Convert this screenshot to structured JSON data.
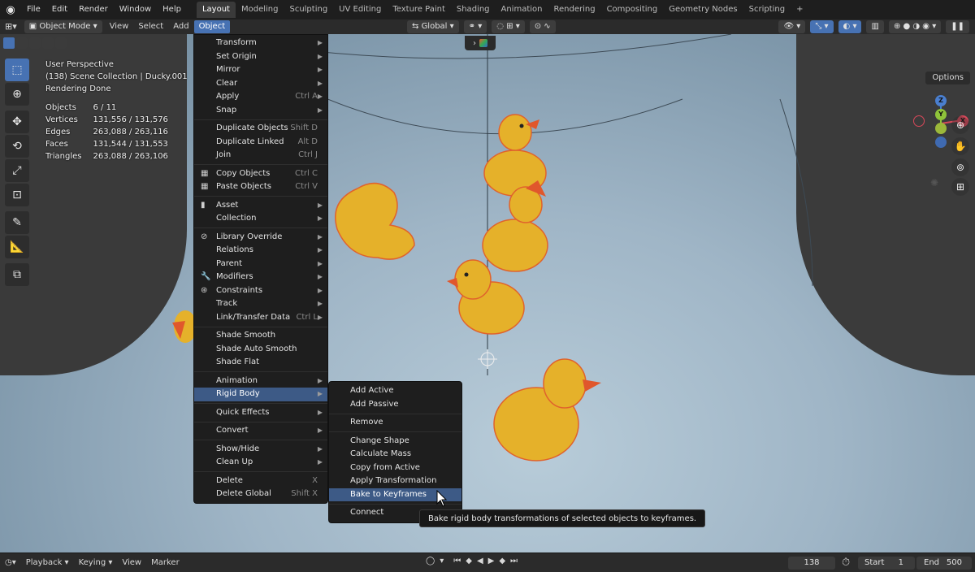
{
  "topbar": {
    "menus": [
      "File",
      "Edit",
      "Render",
      "Window",
      "Help"
    ],
    "workspaces": [
      "Layout",
      "Modeling",
      "Sculpting",
      "UV Editing",
      "Texture Paint",
      "Shading",
      "Animation",
      "Rendering",
      "Compositing",
      "Geometry Nodes",
      "Scripting"
    ],
    "add_tab": "+"
  },
  "header": {
    "mode": "Object Mode",
    "menus": [
      "View",
      "Select",
      "Add",
      "Object"
    ],
    "transform_orientation": "Global",
    "options": "Options"
  },
  "stats": {
    "view": "User Perspective",
    "collection": "(138) Scene Collection | Ducky.001",
    "status": "Rendering Done",
    "rows": [
      {
        "label": "Objects",
        "value": "6 / 11"
      },
      {
        "label": "Vertices",
        "value": "131,556 / 131,576"
      },
      {
        "label": "Edges",
        "value": "263,088 / 263,116"
      },
      {
        "label": "Faces",
        "value": "131,544 / 131,553"
      },
      {
        "label": "Triangles",
        "value": "263,088 / 263,106"
      }
    ]
  },
  "object_menu": [
    {
      "label": "Transform",
      "sub": true
    },
    {
      "label": "Set Origin",
      "sub": true
    },
    {
      "label": "Mirror",
      "sub": true
    },
    {
      "label": "Clear",
      "sub": true
    },
    {
      "label": "Apply",
      "shortcut": "Ctrl A",
      "sub": true
    },
    {
      "label": "Snap",
      "sub": true
    },
    {
      "sep": true
    },
    {
      "label": "Duplicate Objects",
      "shortcut": "Shift D"
    },
    {
      "label": "Duplicate Linked",
      "shortcut": "Alt D"
    },
    {
      "label": "Join",
      "shortcut": "Ctrl J"
    },
    {
      "sep": true
    },
    {
      "label": "Copy Objects",
      "shortcut": "Ctrl C",
      "icon": "▦"
    },
    {
      "label": "Paste Objects",
      "shortcut": "Ctrl V",
      "icon": "▦"
    },
    {
      "sep": true
    },
    {
      "label": "Asset",
      "sub": true,
      "icon": "▮"
    },
    {
      "label": "Collection",
      "sub": true
    },
    {
      "sep": true
    },
    {
      "label": "Library Override",
      "sub": true,
      "icon": "⊘"
    },
    {
      "label": "Relations",
      "sub": true
    },
    {
      "label": "Parent",
      "sub": true
    },
    {
      "label": "Modifiers",
      "sub": true,
      "icon": "🔧"
    },
    {
      "label": "Constraints",
      "sub": true,
      "icon": "⊛"
    },
    {
      "label": "Track",
      "sub": true
    },
    {
      "label": "Link/Transfer Data",
      "shortcut": "Ctrl L",
      "sub": true
    },
    {
      "sep": true
    },
    {
      "label": "Shade Smooth"
    },
    {
      "label": "Shade Auto Smooth"
    },
    {
      "label": "Shade Flat"
    },
    {
      "sep": true
    },
    {
      "label": "Animation",
      "sub": true
    },
    {
      "label": "Rigid Body",
      "sub": true,
      "highlight": true
    },
    {
      "sep": true
    },
    {
      "label": "Quick Effects",
      "sub": true
    },
    {
      "sep": true
    },
    {
      "label": "Convert",
      "sub": true
    },
    {
      "sep": true
    },
    {
      "label": "Show/Hide",
      "sub": true
    },
    {
      "label": "Clean Up",
      "sub": true
    },
    {
      "sep": true
    },
    {
      "label": "Delete",
      "shortcut": "X"
    },
    {
      "label": "Delete Global",
      "shortcut": "Shift X"
    }
  ],
  "rigid_body_menu": [
    {
      "label": "Add Active"
    },
    {
      "label": "Add Passive"
    },
    {
      "sep": true
    },
    {
      "label": "Remove"
    },
    {
      "sep": true
    },
    {
      "label": "Change Shape"
    },
    {
      "label": "Calculate Mass"
    },
    {
      "label": "Copy from Active"
    },
    {
      "label": "Apply Transformation"
    },
    {
      "label": "Bake to Keyframes",
      "highlight": true
    },
    {
      "sep": true
    },
    {
      "label": "Connect"
    }
  ],
  "tooltip": "Bake rigid body transformations of selected objects to keyframes.",
  "gizmo": {
    "z": "Z",
    "y": "Y",
    "x": "X"
  },
  "timeline": {
    "playback": "Playback",
    "keying": "Keying",
    "view": "View",
    "marker": "Marker",
    "current_frame": "138",
    "start_label": "Start",
    "start": "1",
    "end_label": "End",
    "end": "500"
  },
  "colors": {
    "accent": "#4772b3",
    "highlight": "#3d5a86",
    "duck": "#e8b52a",
    "beak": "#e0572c"
  }
}
